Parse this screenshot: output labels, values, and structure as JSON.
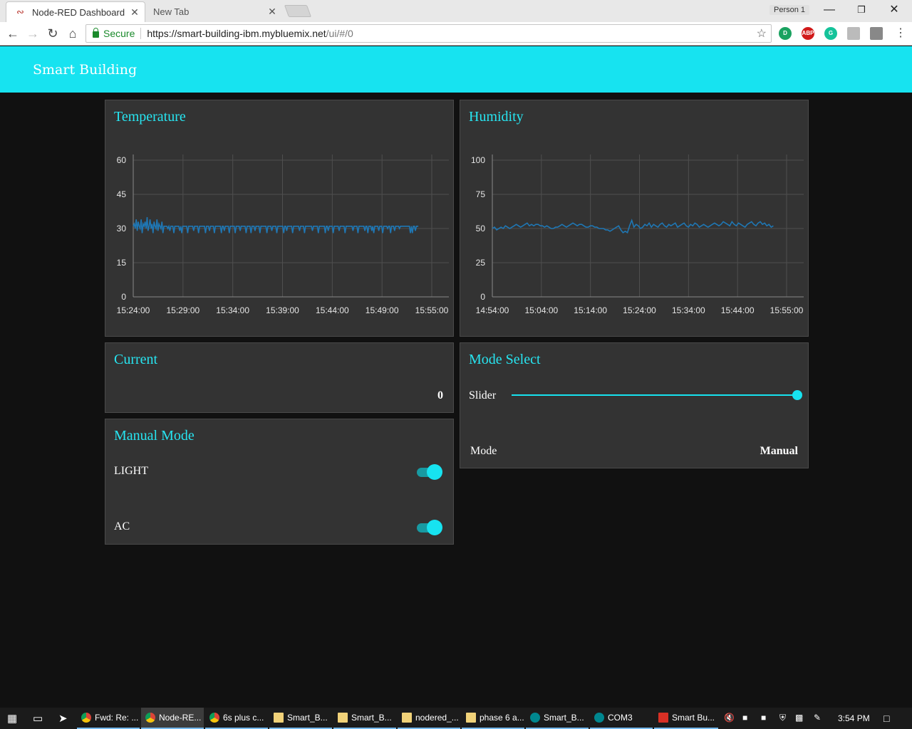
{
  "browser": {
    "tabs": [
      {
        "title": "Node-RED Dashboard",
        "active": true
      },
      {
        "title": "New Tab",
        "active": false
      }
    ],
    "profile": "Person 1",
    "secure_label": "Secure",
    "url_main": "https://smart-building-ibm.mybluemix.net",
    "url_rest": "/ui/#/0"
  },
  "dashboard": {
    "title": "Smart Building"
  },
  "temperature": {
    "title": "Temperature"
  },
  "humidity": {
    "title": "Humidity"
  },
  "current": {
    "title": "Current",
    "value": "0"
  },
  "mode_select": {
    "title": "Mode Select",
    "slider_label": "Slider",
    "slider_value_fraction": 1.0,
    "mode_label": "Mode",
    "mode_value": "Manual"
  },
  "manual_mode": {
    "title": "Manual Mode",
    "light_label": "LIGHT",
    "light_on": true,
    "ac_label": "AC",
    "ac_on": true
  },
  "colors": {
    "accent": "#17e3f0",
    "series": "#1f77b4",
    "card": "#333333",
    "background": "#111111"
  },
  "chart_data": [
    {
      "type": "line",
      "title": "Temperature",
      "x_ticks": [
        "15:24:00",
        "15:29:00",
        "15:34:00",
        "15:39:00",
        "15:44:00",
        "15:49:00",
        "15:55:00"
      ],
      "y_ticks": [
        "0",
        "15",
        "30",
        "45",
        "60"
      ],
      "ylim": [
        0,
        60
      ],
      "grid": true,
      "series": [
        {
          "values": [
            31,
            32,
            30,
            34,
            29,
            33,
            31,
            30,
            34,
            28,
            32,
            31,
            33,
            30,
            35,
            29,
            31,
            34,
            30,
            32,
            28,
            33,
            31,
            30,
            34,
            29,
            32,
            31,
            30,
            33,
            28,
            31,
            31,
            31,
            31,
            30,
            31,
            29,
            31,
            31,
            31,
            28,
            31,
            31,
            31,
            31,
            31,
            29,
            31,
            28,
            31,
            31,
            31,
            31,
            31,
            28,
            31,
            31,
            31,
            31,
            31,
            29,
            31,
            31,
            31,
            31,
            28,
            31,
            31,
            31,
            31,
            31,
            31,
            28,
            31,
            31,
            31,
            29,
            31,
            31,
            31,
            31,
            28,
            31,
            31,
            31,
            31,
            31,
            31,
            28,
            31,
            31,
            29,
            31,
            31,
            31,
            31,
            28,
            31,
            31,
            31,
            31,
            31,
            28,
            31,
            31,
            31,
            31,
            29,
            31,
            31,
            31,
            31,
            31,
            28,
            31,
            31,
            31,
            31,
            28,
            31,
            31,
            31,
            29,
            31,
            31,
            31,
            31,
            28,
            31,
            31,
            31,
            31,
            31,
            31,
            28,
            31,
            31,
            31,
            31,
            29,
            31,
            31,
            31,
            31,
            28,
            31,
            31,
            31,
            31,
            31,
            31,
            28,
            31,
            31,
            29,
            31,
            31,
            31,
            31,
            31,
            28,
            31,
            31,
            31,
            31,
            31,
            31,
            29,
            31,
            31,
            31,
            31,
            28,
            31,
            31,
            31,
            31,
            31,
            31,
            31,
            29,
            31,
            31,
            31,
            31,
            31,
            28,
            31,
            31,
            31,
            31,
            31,
            31,
            28,
            31,
            31,
            29,
            31,
            31,
            31,
            31,
            28,
            31,
            31,
            31,
            31,
            31,
            29,
            31,
            31,
            31,
            31,
            31,
            28,
            31,
            31,
            31,
            31,
            31,
            31,
            31,
            29,
            31,
            31,
            31,
            31,
            28,
            31,
            31,
            31,
            31,
            31,
            31,
            29,
            31,
            31,
            28,
            31,
            31,
            31,
            29,
            31,
            28,
            31,
            31,
            31,
            31,
            29,
            31,
            31,
            31,
            28,
            31,
            31,
            31,
            31,
            30,
            31,
            31,
            28,
            31,
            31,
            31,
            29,
            31,
            31,
            31,
            31,
            30,
            31,
            31,
            31,
            31,
            31,
            31,
            31,
            31,
            31,
            31,
            28,
            31,
            28,
            31,
            31,
            29,
            31,
            31,
            31
          ]
        }
      ]
    },
    {
      "type": "line",
      "title": "Humidity",
      "x_ticks": [
        "14:54:00",
        "15:04:00",
        "15:14:00",
        "15:24:00",
        "15:34:00",
        "15:44:00",
        "15:55:00"
      ],
      "y_ticks": [
        "0",
        "25",
        "50",
        "75",
        "100"
      ],
      "ylim": [
        0,
        100
      ],
      "grid": true,
      "series": [
        {
          "values": [
            50,
            51,
            49,
            50,
            51,
            50,
            52,
            51,
            50,
            51,
            52,
            53,
            52,
            51,
            52,
            53,
            54,
            52,
            53,
            52,
            53,
            53,
            52,
            52,
            51,
            52,
            51,
            50,
            50,
            51,
            51,
            52,
            53,
            52,
            51,
            52,
            53,
            54,
            53,
            52,
            53,
            53,
            52,
            51,
            51,
            52,
            52,
            51,
            51,
            50,
            50,
            50,
            49,
            49,
            48,
            49,
            50,
            51,
            52,
            49,
            47,
            48,
            47,
            52,
            56,
            51,
            53,
            52,
            50,
            51,
            53,
            52,
            54,
            51,
            53,
            52,
            51,
            53,
            54,
            52,
            51,
            53,
            52,
            53,
            54,
            51,
            52,
            53,
            54,
            52,
            51,
            53,
            52,
            54,
            53,
            51,
            52,
            53,
            52,
            51,
            52,
            53,
            54,
            53,
            52,
            53,
            55,
            54,
            53,
            52,
            55,
            53,
            52,
            54,
            53,
            52,
            51,
            53,
            54,
            55,
            53,
            52,
            54,
            55,
            53,
            54,
            52,
            53,
            51,
            52
          ]
        }
      ]
    }
  ]
}
